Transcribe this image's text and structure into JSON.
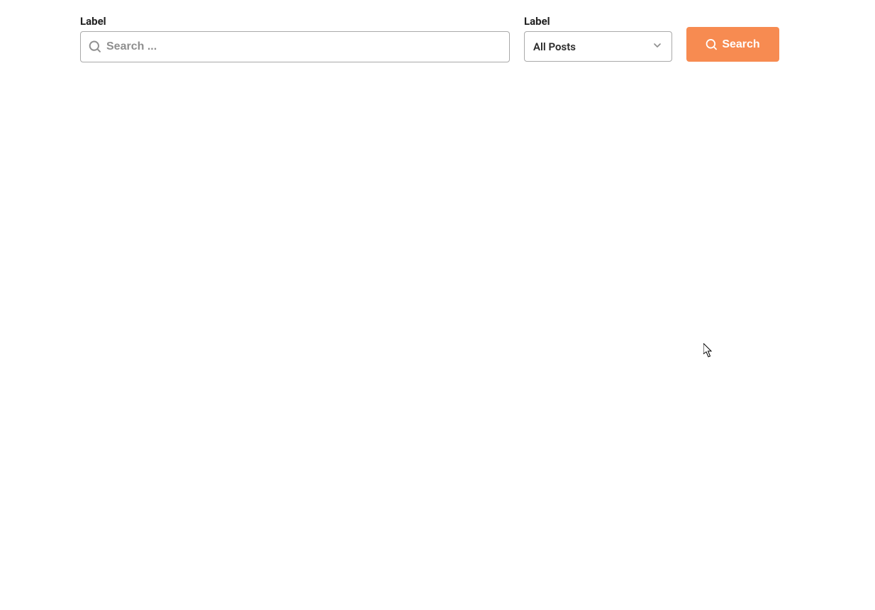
{
  "searchField": {
    "label": "Label",
    "placeholder": "Search ...",
    "value": ""
  },
  "categorySelect": {
    "label": "Label",
    "selected": "All Posts"
  },
  "searchButton": {
    "label": "Search"
  }
}
